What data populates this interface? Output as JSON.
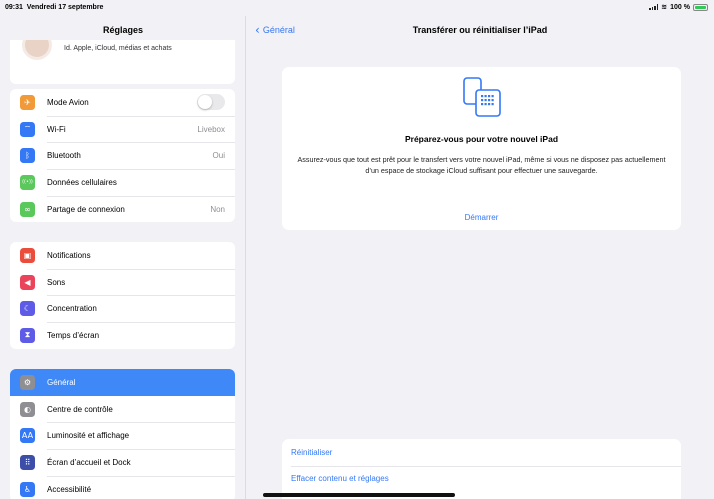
{
  "status": {
    "time": "09:31",
    "date": "Vendredi 17 septembre",
    "battery": "100 %"
  },
  "sidebar": {
    "title": "Réglages",
    "profile_subtitle": "Id. Apple, iCloud, médias et achats",
    "group1": [
      {
        "label": "Mode Avion",
        "icon": "airplane-icon",
        "color": "#f19a37",
        "glyph": "✈",
        "toggle": false
      },
      {
        "label": "Wi-Fi",
        "value": "Livebox",
        "icon": "wifi-icon",
        "color": "#3478f6",
        "glyph": "⌔"
      },
      {
        "label": "Bluetooth",
        "value": "Oui",
        "icon": "bluetooth-icon",
        "color": "#3478f6",
        "glyph": "ᛒ"
      },
      {
        "label": "Données cellulaires",
        "icon": "antenna-icon",
        "color": "#5ac85a",
        "glyph": "((•))"
      },
      {
        "label": "Partage de connexion",
        "value": "Non",
        "icon": "hotspot-icon",
        "color": "#5ac85a",
        "glyph": "∞"
      }
    ],
    "group2": [
      {
        "label": "Notifications",
        "icon": "notifications-icon",
        "color": "#eb4d3d",
        "glyph": "▣"
      },
      {
        "label": "Sons",
        "icon": "speaker-icon",
        "color": "#eb445a",
        "glyph": "◀"
      },
      {
        "label": "Concentration",
        "icon": "moon-icon",
        "color": "#5e5ce6",
        "glyph": "☾"
      },
      {
        "label": "Temps d’écran",
        "icon": "hourglass-icon",
        "color": "#5e5ce6",
        "glyph": "⧗"
      }
    ],
    "group3": [
      {
        "label": "Général",
        "icon": "gear-icon",
        "color": "#8e8e93",
        "glyph": "⚙",
        "selected": true
      },
      {
        "label": "Centre de contrôle",
        "icon": "toggles-icon",
        "color": "#8e8e93",
        "glyph": "◐"
      },
      {
        "label": "Luminosité et affichage",
        "icon": "brightness-icon",
        "color": "#3478f6",
        "glyph": "AA"
      },
      {
        "label": "Écran d’accueil et Dock",
        "icon": "homescreen-icon",
        "color": "#3d4ea8",
        "glyph": "⠿"
      },
      {
        "label": "Accessibilité",
        "icon": "accessibility-icon",
        "color": "#3478f6",
        "glyph": "♿"
      }
    ]
  },
  "main": {
    "back_label": "Général",
    "title": "Transférer ou réinitialiser l’iPad",
    "card": {
      "title": "Préparez-vous pour votre nouvel iPad",
      "description": "Assurez-vous que tout est prêt pour le transfert vers votre nouvel iPad, même si vous ne disposez pas actuellement d’un espace de stockage iCloud suffisant pour effectuer une sauvegarde.",
      "link": "Démarrer"
    },
    "reset_label": "Réinitialiser",
    "erase_label": "Effacer contenu et réglages"
  },
  "colors": {
    "accent": "#3478f6",
    "selected": "#3e88f7",
    "background": "#f2f1f6"
  }
}
